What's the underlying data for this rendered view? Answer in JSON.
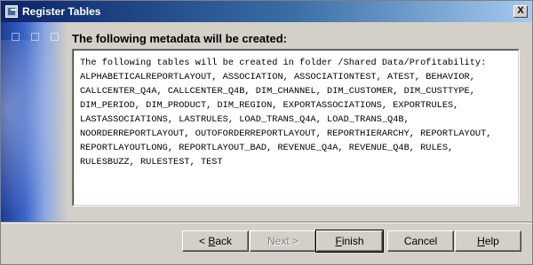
{
  "window": {
    "title": "Register Tables",
    "close_symbol": "X"
  },
  "heading": "The following metadata will be created:",
  "message": "The following tables will be created in folder /Shared Data/Profitability:\nALPHABETICALREPORTLAYOUT, ASSOCIATION, ASSOCIATIONTEST, ATEST, BEHAVIOR, CALLCENTER_Q4A, CALLCENTER_Q4B, DIM_CHANNEL, DIM_CUSTOMER, DIM_CUSTTYPE, DIM_PERIOD, DIM_PRODUCT, DIM_REGION, EXPORTASSOCIATIONS, EXPORTRULES, LASTASSOCIATIONS, LASTRULES, LOAD_TRANS_Q4A, LOAD_TRANS_Q4B, NOORDERREPORTLAYOUT, OUTOFORDERREPORTLAYOUT, REPORTHIERARCHY, REPORTLAYOUT, REPORTLAYOUTLONG, REPORTLAYOUT_BAD, REVENUE_Q4A, REVENUE_Q4B, RULES, RULESBUZZ, RULESTEST, TEST",
  "buttons": {
    "back": {
      "prefix": "< ",
      "mnemonic": "B",
      "rest": "ack",
      "enabled": true
    },
    "next": {
      "label": "Next >",
      "enabled": false
    },
    "finish": {
      "mnemonic": "F",
      "rest": "inish",
      "enabled": true
    },
    "cancel": {
      "label": "Cancel",
      "enabled": true
    },
    "help": {
      "mnemonic": "H",
      "rest": "elp",
      "enabled": true
    }
  },
  "icons": {
    "app": "register-tables-app-icon",
    "close": "close-icon"
  },
  "colors": {
    "titlebar_start": "#0a246a",
    "titlebar_end": "#a6caf0",
    "dialog_face": "#d4d0c8"
  }
}
